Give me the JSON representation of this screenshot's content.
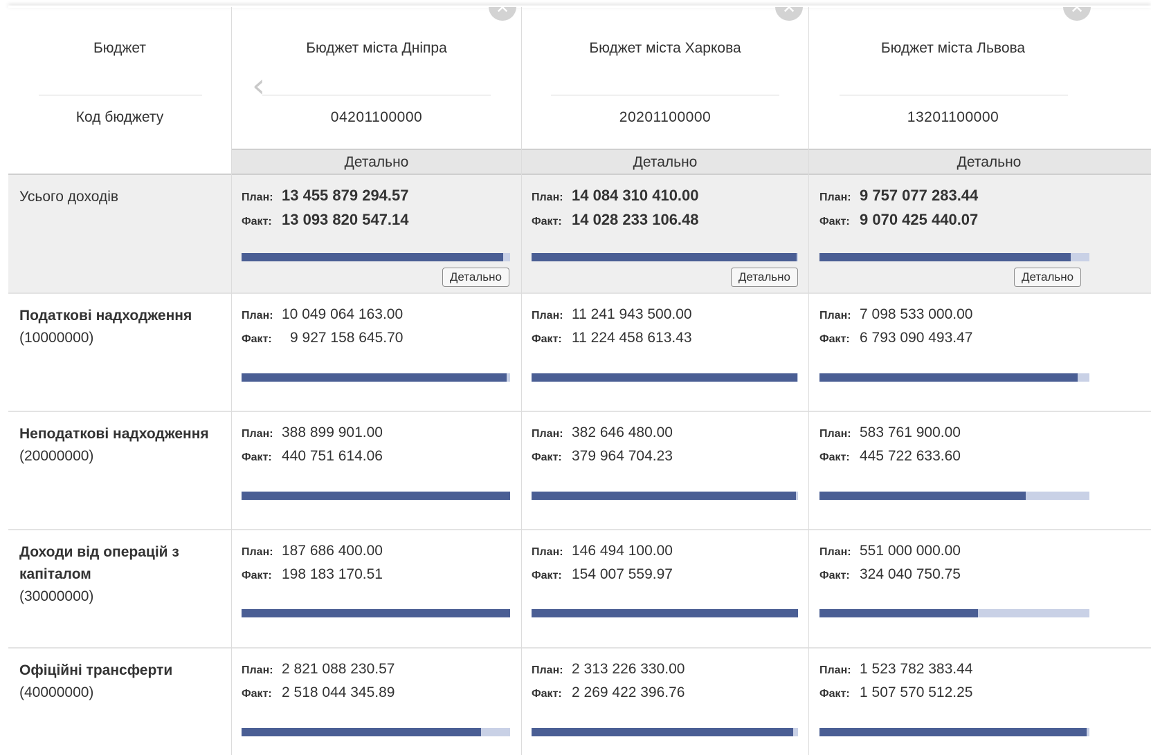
{
  "header": {
    "budget_label": "Бюджет",
    "code_label": "Код бюджету",
    "detail_label": "Детально"
  },
  "columns": [
    {
      "title": "Бюджет міста Дніпра",
      "code": "04201100000"
    },
    {
      "title": "Бюджет міста Харкова",
      "code": "20201100000"
    },
    {
      "title": "Бюджет міста Львова",
      "code": "13201100000"
    }
  ],
  "labels": {
    "plan": "План:",
    "fact": "Факт:"
  },
  "rows": [
    {
      "name": "Усього доходів",
      "code": "",
      "cells": [
        {
          "plan": "13 455 879 294.57",
          "fact": "13 093 820 547.14",
          "progress": 0.973
        },
        {
          "plan": "14 084 310 410.00",
          "fact": "14 028 233 106.48",
          "progress": 0.996
        },
        {
          "plan": "9 757 077 283.44",
          "fact": "9 070 425 440.07",
          "progress": 0.93
        }
      ]
    },
    {
      "name": "Податкові надходження",
      "code": "(10000000)",
      "cells": [
        {
          "plan": "10 049 064 163.00",
          "fact": "9 927 158 645.70",
          "progress": 0.988
        },
        {
          "plan": "11 241 943 500.00",
          "fact": "11 224 458 613.43",
          "progress": 0.998
        },
        {
          "plan": "7 098 533 000.00",
          "fact": "6 793 090 493.47",
          "progress": 0.957
        }
      ]
    },
    {
      "name": "Неподаткові надходження",
      "code": "(20000000)",
      "cells": [
        {
          "plan": "388 899 901.00",
          "fact": "440 751 614.06",
          "progress": 1.0
        },
        {
          "plan": "382 646 480.00",
          "fact": "379 964 704.23",
          "progress": 0.993
        },
        {
          "plan": "583 761 900.00",
          "fact": "445 722 633.60",
          "progress": 0.764
        }
      ]
    },
    {
      "name": "Доходи від операцій з капіталом",
      "code": "(30000000)",
      "cells": [
        {
          "plan": "187 686 400.00",
          "fact": "198 183 170.51",
          "progress": 1.0
        },
        {
          "plan": "146 494 100.00",
          "fact": "154 007 559.97",
          "progress": 1.0
        },
        {
          "plan": "551 000 000.00",
          "fact": "324 040 750.75",
          "progress": 0.588
        }
      ]
    },
    {
      "name": "Офіційні трансферти",
      "code": "(40000000)",
      "cells": [
        {
          "plan": "2 821 088 230.57",
          "fact": "2 518 044 345.89",
          "progress": 0.893
        },
        {
          "plan": "2 313 226 330.00",
          "fact": "2 269 422 396.76",
          "progress": 0.981
        },
        {
          "plan": "1 523 782 383.44",
          "fact": "1 507 570 512.25",
          "progress": 0.989
        }
      ]
    }
  ],
  "icons": {
    "close": "close-icon",
    "prev": "chevron-left-icon"
  },
  "colors": {
    "bar_fill": "#4a5e94",
    "bar_track": "#c9d1e6"
  }
}
